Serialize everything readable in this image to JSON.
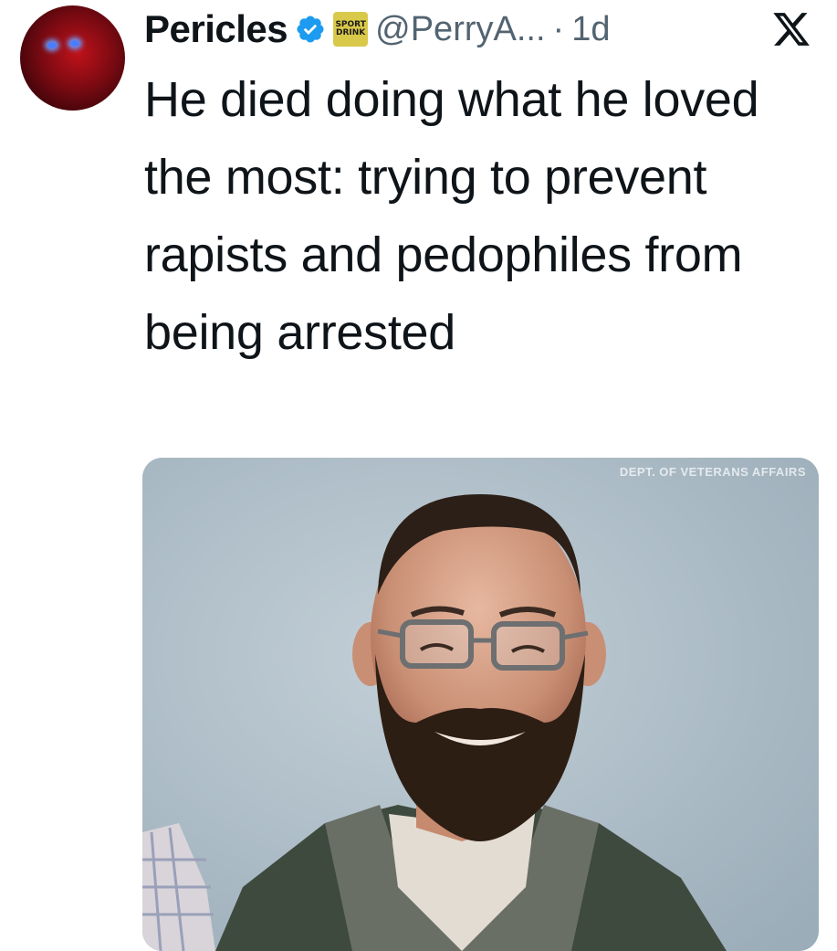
{
  "tweet": {
    "author_name": "Pericles",
    "affiliation_badge": [
      "SPORT",
      "DRINK"
    ],
    "handle": "@PerryA...",
    "separator": "·",
    "time": "1d",
    "text": "He died doing what he loved the most: trying to prevent rapists and pedophiles from being arrested",
    "media_watermark": "DEPT. OF VETERANS AFFAIRS"
  },
  "icons": {
    "verified": "verified-badge-icon",
    "x_logo": "x-logo-icon"
  },
  "colors": {
    "text": "#0f1419",
    "secondary": "#536471",
    "verified_blue": "#1d9bf0",
    "badge_gold": "#d9c94a"
  }
}
